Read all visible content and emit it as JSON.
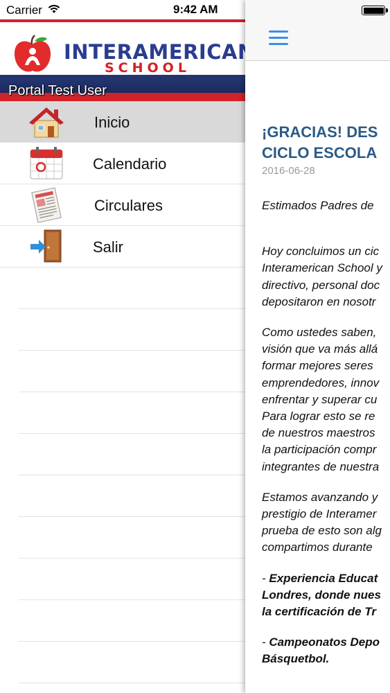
{
  "status": {
    "carrier": "Carrier",
    "time": "9:42 AM"
  },
  "brand": {
    "name": "INTERAMERICAN",
    "sub": "SCHOOL",
    "user": "Portal Test User",
    "colors": {
      "red": "#d42027",
      "blue": "#2a3d8f"
    }
  },
  "menu": {
    "items": [
      {
        "label": "Inicio",
        "icon": "house-icon",
        "selected": true
      },
      {
        "label": "Calendario",
        "icon": "calendar-icon"
      },
      {
        "label": "Circulares",
        "icon": "newspaper-icon"
      },
      {
        "label": "Salir",
        "icon": "exit-door-icon"
      }
    ]
  },
  "content": {
    "nav_icon": "hamburger-menu-icon",
    "accent": "#3a8ee6",
    "title_line1": "¡GRACIAS! DES",
    "title_line2": "CICLO ESCOLA",
    "date": "2016-06-28",
    "greeting": "Estimados Padres de",
    "p1": [
      "Hoy concluimos un cic",
      "Interamerican School y",
      "directivo, personal doc",
      "depositaron en nosotr"
    ],
    "p2": [
      "Como ustedes saben,",
      "visión que va más allá",
      "formar mejores seres",
      "emprendedores, innov",
      "enfrentar y superar cu",
      "Para lograr esto se re",
      "de nuestros  maestros",
      "la participación compr",
      "integrantes de nuestra"
    ],
    "p3": [
      "Estamos avanzando y",
      "prestigio de Interamer",
      "prueba de esto son alg",
      "compartimos durante"
    ],
    "b1_dash": "- ",
    "b1": [
      "Experiencia Educat",
      "Londres, donde nues",
      "la certificación de Tr"
    ],
    "b2_dash": "- ",
    "b2": [
      "Campeonatos Depo",
      "Básquetbol."
    ]
  }
}
